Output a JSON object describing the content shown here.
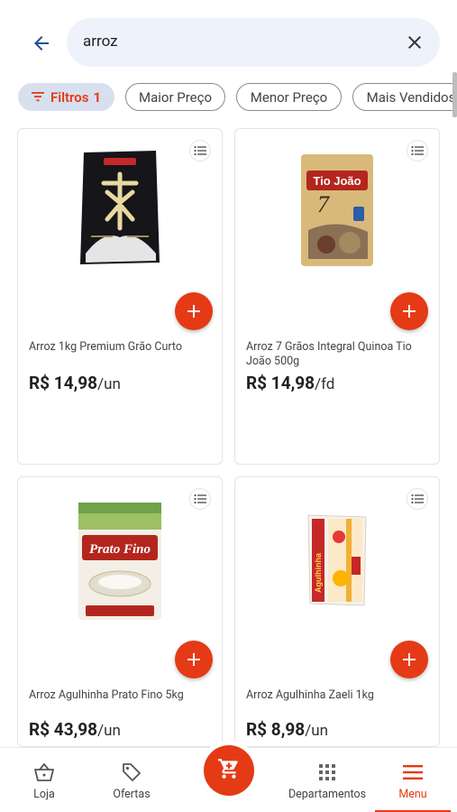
{
  "search": {
    "query": "arroz"
  },
  "chips": {
    "filter_label": "Filtros",
    "filter_count": "1",
    "sort_options": [
      "Maior Preço",
      "Menor Preço",
      "Mais Vendidos"
    ]
  },
  "products": [
    {
      "name": "Arroz 1kg Premium Grão Curto",
      "price": "R$ 14,98",
      "unit": "/un"
    },
    {
      "name": "Arroz 7 Grãos Integral Quinoa Tio João 500g",
      "price": "R$ 14,98",
      "unit": "/fd"
    },
    {
      "name": "Arroz Agulhinha Prato Fino 5kg",
      "price": "R$ 43,98",
      "unit": "/un"
    },
    {
      "name": "Arroz Agulhinha Zaeli 1kg",
      "price": "R$ 8,98",
      "unit": "/un"
    }
  ],
  "package_text": {
    "tio_joao_brand": "Tio João",
    "prato_fino_brand": "Prato Fino",
    "zaeli_side": "Agulhinha"
  },
  "bottom_nav": {
    "loja": "Loja",
    "ofertas": "Ofertas",
    "departamentos": "Departamentos",
    "menu": "Menu"
  },
  "colors": {
    "accent": "#e53a16",
    "search_bg": "#eef2fb",
    "chip_bg": "#d8e0ef"
  }
}
